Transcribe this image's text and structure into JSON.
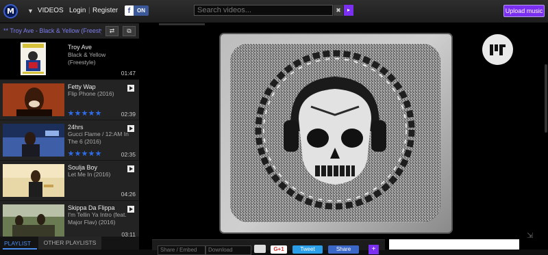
{
  "header": {
    "logo_glyph": "M",
    "nav_videos": "VIDEOS",
    "nav_login": "Login",
    "nav_separator": "|",
    "nav_register": "Register",
    "fb_letter": "f",
    "fb_state": "ON",
    "search_placeholder": "Search videos...",
    "search_clear": "✖",
    "search_go": "▸",
    "upload_label": "Upload music"
  },
  "now_playing": {
    "title": "** Troy Ave - Black & Yellow (Freestyle)"
  },
  "playlist": [
    {
      "artist": "Troy Ave",
      "song": "Black & Yellow (Freestyle)",
      "duration": "01:47"
    },
    {
      "artist": "Fetty Wap",
      "song": "Flip Phone (2016)",
      "duration": "02:39",
      "stars": 5
    },
    {
      "artist": "24hrs",
      "song": "Gucci Flame / 12:AM In The 6 (2016)",
      "duration": "02:35",
      "stars": 5
    },
    {
      "artist": "Soulja Boy",
      "song": "Let Me In (2016)",
      "duration": "04:26"
    },
    {
      "artist": "Skippa Da Flippa",
      "song": "I'm Tellin Ya Intro (feat. Major Flav) (2016)",
      "duration": "03:11"
    }
  ],
  "tabs": {
    "playlist": "PLAYLIST",
    "other": "OTHER PLAYLISTS"
  },
  "share_bar": {
    "share_placeholder": "Share / Embed",
    "download_placeholder": "Download",
    "gplus": "G+1",
    "tweet": "Tweet",
    "fb_share": "Share",
    "plus": "+"
  },
  "colors": {
    "accent": "#7b2ff0",
    "link_blue": "#4a8ef0",
    "star_blue": "#2f6de8"
  }
}
